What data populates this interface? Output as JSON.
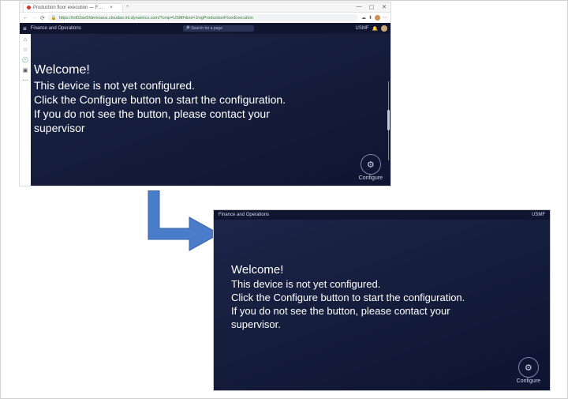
{
  "browser": {
    "tab_title": "Production floor execution — F…",
    "url": "https://int02ae5fdemoaos.cloudax.int.dynamics.com/?cmp=USMF&mi=JmgProductionFloorExecution",
    "win_min": "—",
    "win_max": "▢",
    "win_close": "✕",
    "nav_back": "←",
    "nav_fwd": "→",
    "nav_reload": "⟳",
    "lock": "🔒",
    "ext1": "⋯",
    "ext2": "☁",
    "ext3": "⬇"
  },
  "fo": {
    "hamburger": "≡",
    "app_name": "Finance and Operations",
    "search_placeholder": "🔎 Search for a page",
    "company": "USMF",
    "bell": "🔔",
    "rail": {
      "i1": "⌂",
      "i2": "☆",
      "i3": "🕑",
      "i4": "⋯",
      "i5": "▣"
    }
  },
  "welcome": {
    "head": "Welcome!",
    "l1": "This device is not yet configured.",
    "l2": "Click the Configure button to start the configuration.",
    "l3": "If you do not see the button, please contact your",
    "l4_cut": "supervisor",
    "l4_full": "supervisor."
  },
  "configure": {
    "gear": "⚙",
    "label": "Configure"
  }
}
